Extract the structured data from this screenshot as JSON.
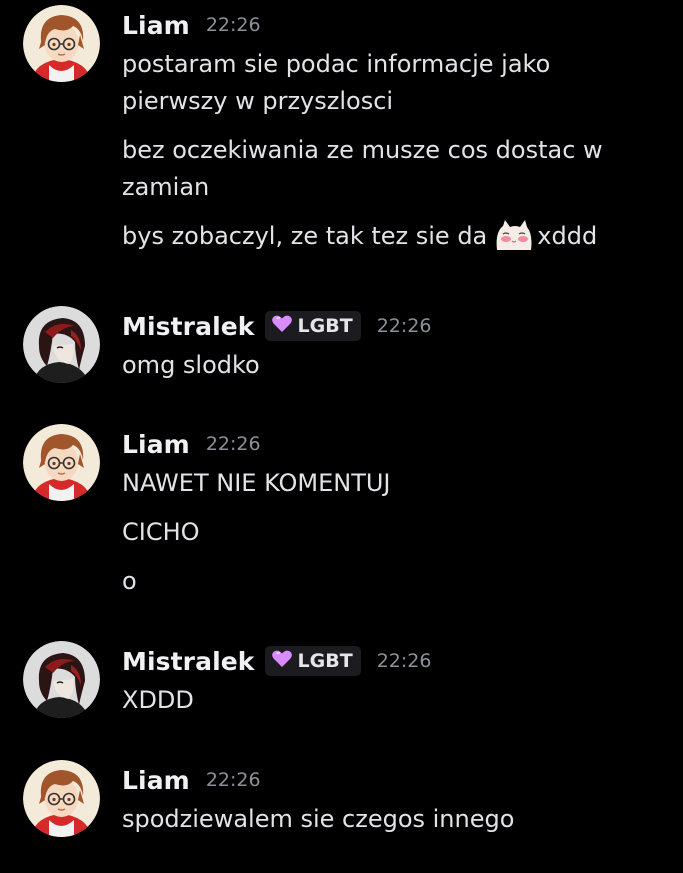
{
  "colors": {
    "background": "#000000",
    "username": "#f1f1f4",
    "timestamp": "#8e9099",
    "message_text": "#e3e3e7",
    "tag_background": "#1b1b20",
    "tag_heart": "#d88cff"
  },
  "messages": [
    {
      "author": "Liam",
      "avatar": "liam-avatar",
      "time": "22:26",
      "lines": [
        "postaram sie podac informacje jako pierwszy w przyszlosci",
        "bez oczekiwania ze musze cos dostac w zamian",
        {
          "before": "bys zobaczyl, ze tak tez sie da",
          "emoji": "blushing-cat-emoji",
          "after": "xddd"
        }
      ]
    },
    {
      "author": "Mistralek",
      "avatar": "mistralek-avatar",
      "tag": {
        "icon": "heart-icon",
        "label": "LGBT"
      },
      "time": "22:26",
      "lines": [
        "omg slodko"
      ]
    },
    {
      "author": "Liam",
      "avatar": "liam-avatar",
      "time": "22:26",
      "lines": [
        "NAWET NIE KOMENTUJ",
        "CICHO",
        "o"
      ]
    },
    {
      "author": "Mistralek",
      "avatar": "mistralek-avatar",
      "tag": {
        "icon": "heart-icon",
        "label": "LGBT"
      },
      "time": "22:26",
      "lines": [
        "XDDD"
      ]
    },
    {
      "author": "Liam",
      "avatar": "liam-avatar",
      "time": "22:26",
      "lines": [
        "spodziewalem sie czegos innego"
      ]
    }
  ]
}
